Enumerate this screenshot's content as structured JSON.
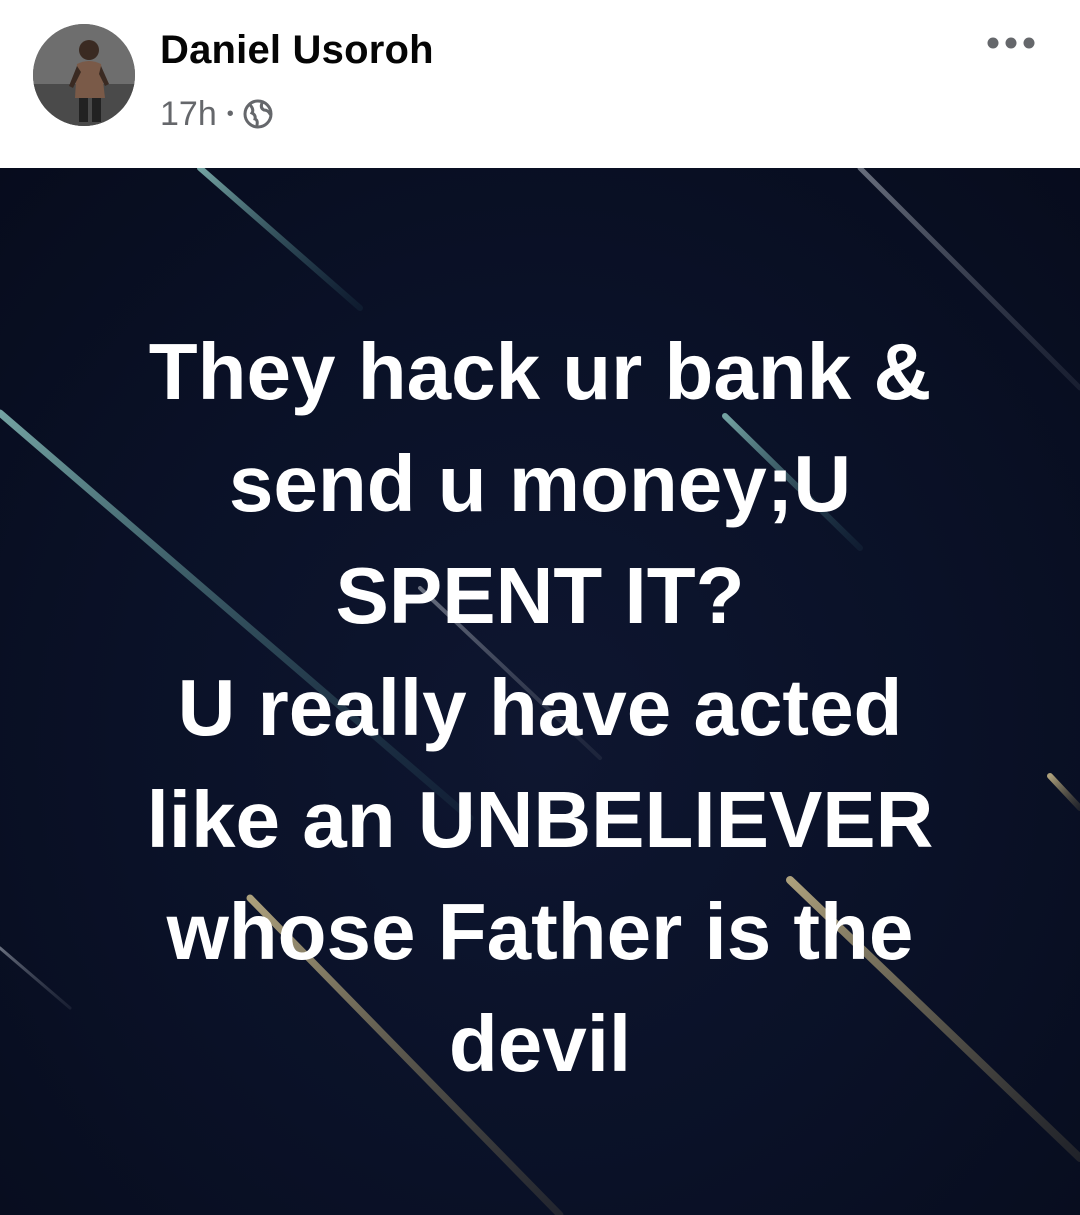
{
  "author": {
    "name": "Daniel Usoroh"
  },
  "meta": {
    "time": "17h",
    "separator": "•",
    "privacy_icon": "globe-icon"
  },
  "actions": {
    "more_icon": "more-options-icon"
  },
  "post": {
    "background": "dark navy with diagonal light streaks",
    "lines": [
      "They hack ur bank &",
      "send u money;U",
      "SPENT IT?",
      "U really have acted",
      "like an UNBELIEVER",
      "whose Father is the",
      "devil"
    ]
  },
  "colors": {
    "name_text": "#050505",
    "meta_text": "#65676b",
    "post_background": "#0a1127",
    "post_text": "#ffffff"
  }
}
